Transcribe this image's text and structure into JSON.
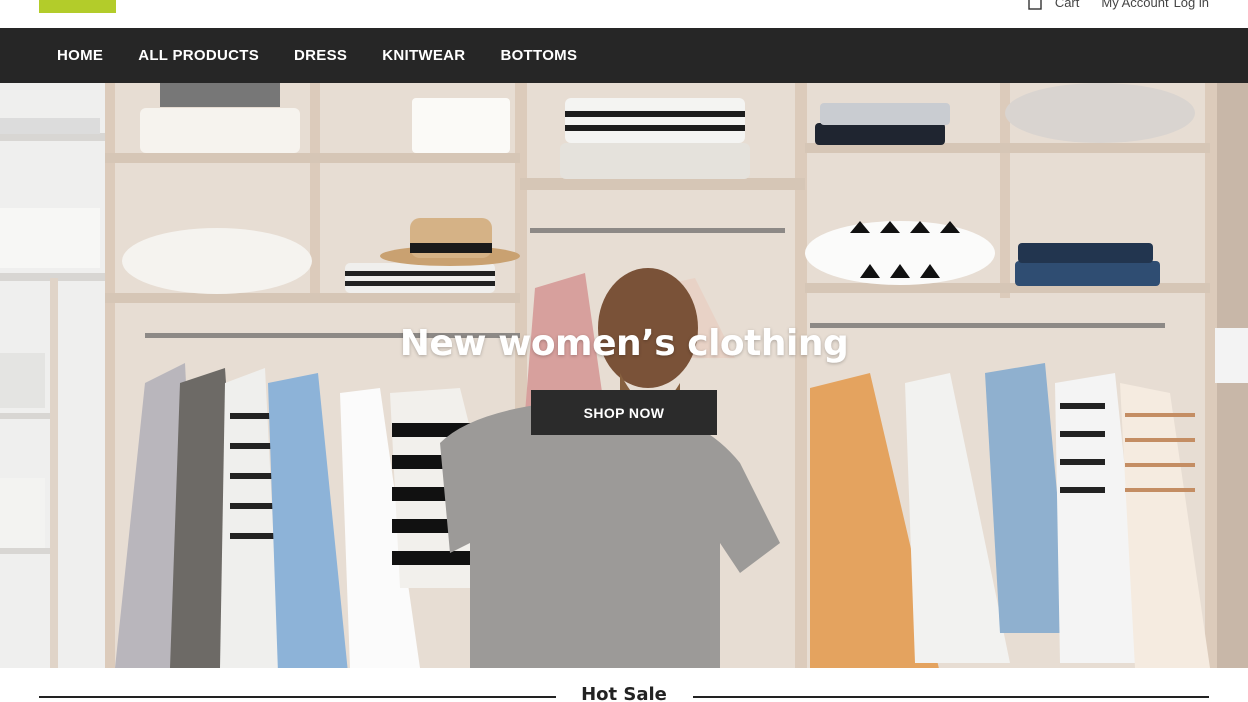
{
  "header": {
    "logo_color": "#b3cc2a",
    "links": {
      "cart": "Cart",
      "account": "My Account",
      "login": "Log in"
    },
    "cart_icon": "bag-icon"
  },
  "nav": {
    "items": [
      {
        "label": "HOME"
      },
      {
        "label": "ALL PRODUCTS"
      },
      {
        "label": "DRESS"
      },
      {
        "label": "KNITWEAR"
      },
      {
        "label": "BOTTOMS"
      }
    ],
    "background": "#262626"
  },
  "hero": {
    "title": "New women’s clothing",
    "button_label": "SHOP NOW"
  },
  "section": {
    "title": "Hot Sale"
  }
}
